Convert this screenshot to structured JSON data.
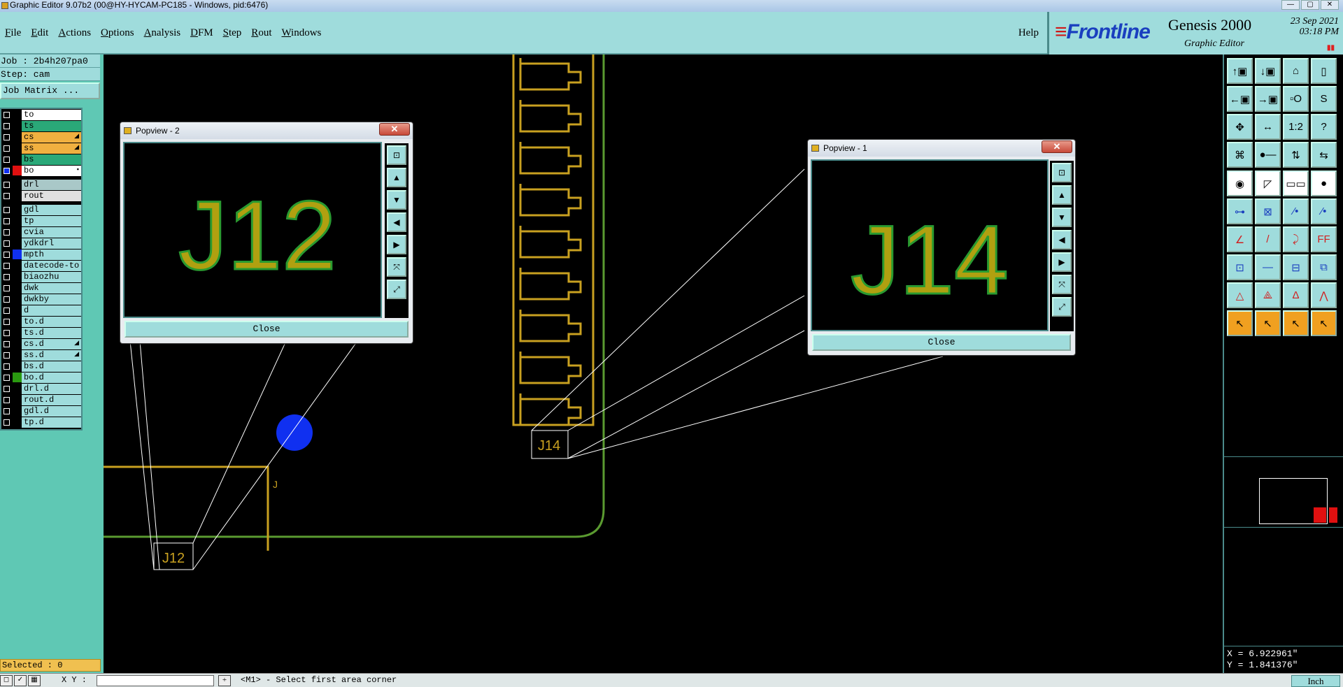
{
  "window": {
    "title": "Graphic Editor 9.07b2 (00@HY-HYCAM-PC185 - Windows, pid:6476)"
  },
  "menu": {
    "items": [
      "File",
      "Edit",
      "Actions",
      "Options",
      "Analysis",
      "DFM",
      "Step",
      "Rout",
      "Windows"
    ],
    "help": "Help"
  },
  "logo": {
    "brand": "Frontline",
    "product": "Genesis 2000",
    "subtitle": "Graphic Editor",
    "date": "23 Sep 2021",
    "time": "03:18 PM"
  },
  "job": {
    "job_line": "Job : 2b4h207pa0",
    "step_line": "Step: cam",
    "matrix_button": "Job Matrix ..."
  },
  "layers": [
    {
      "name": "to",
      "bg": "#ffffff",
      "swatch": "",
      "mark": ""
    },
    {
      "name": "ts",
      "bg": "#2aa878",
      "swatch": "",
      "mark": ""
    },
    {
      "name": "cs",
      "bg": "#f0b040",
      "swatch": "",
      "mark": "◢"
    },
    {
      "name": "ss",
      "bg": "#f0b040",
      "swatch": "",
      "mark": "◢"
    },
    {
      "name": "bs",
      "bg": "#2aa878",
      "swatch": "",
      "mark": ""
    },
    {
      "name": "bo",
      "bg": "#ffffff",
      "swatch": "#e01010",
      "mark": "▪"
    },
    {
      "name": "drl",
      "bg": "#a9c8c8",
      "swatch": "",
      "mark": "",
      "sep": true
    },
    {
      "name": "rout",
      "bg": "#e0e0e0",
      "swatch": "",
      "mark": ""
    },
    {
      "name": "gdl",
      "bg": "#9fdcdc",
      "swatch": "",
      "mark": "",
      "sep": true
    },
    {
      "name": "tp",
      "bg": "#9fdcdc",
      "swatch": "",
      "mark": ""
    },
    {
      "name": "cvia",
      "bg": "#9fdcdc",
      "swatch": "",
      "mark": ""
    },
    {
      "name": "ydkdrl",
      "bg": "#9fdcdc",
      "swatch": "",
      "mark": ""
    },
    {
      "name": "mpth",
      "bg": "#9fdcdc",
      "swatch": "#1030f0",
      "mark": ""
    },
    {
      "name": "datecode-to",
      "bg": "#9fdcdc",
      "swatch": "",
      "mark": ""
    },
    {
      "name": "biaozhu",
      "bg": "#9fdcdc",
      "swatch": "",
      "mark": ""
    },
    {
      "name": "dwk",
      "bg": "#9fdcdc",
      "swatch": "",
      "mark": ""
    },
    {
      "name": "dwkby",
      "bg": "#9fdcdc",
      "swatch": "",
      "mark": ""
    },
    {
      "name": "d",
      "bg": "#9fdcdc",
      "swatch": "",
      "mark": ""
    },
    {
      "name": "to.d",
      "bg": "#9fdcdc",
      "swatch": "",
      "mark": ""
    },
    {
      "name": "ts.d",
      "bg": "#9fdcdc",
      "swatch": "",
      "mark": ""
    },
    {
      "name": "cs.d",
      "bg": "#9fdcdc",
      "swatch": "",
      "mark": "◢"
    },
    {
      "name": "ss.d",
      "bg": "#9fdcdc",
      "swatch": "",
      "mark": "◢"
    },
    {
      "name": "bs.d",
      "bg": "#9fdcdc",
      "swatch": "",
      "mark": ""
    },
    {
      "name": "bo.d",
      "bg": "#9fdcdc",
      "swatch": "#2a9a10",
      "mark": ""
    },
    {
      "name": "drl.d",
      "bg": "#9fdcdc",
      "swatch": "",
      "mark": ""
    },
    {
      "name": "rout.d",
      "bg": "#9fdcdc",
      "swatch": "",
      "mark": ""
    },
    {
      "name": "gdl.d",
      "bg": "#9fdcdc",
      "swatch": "",
      "mark": ""
    },
    {
      "name": "tp.d",
      "bg": "#9fdcdc",
      "swatch": "",
      "mark": ""
    }
  ],
  "status": {
    "selected": "Selected : 0",
    "xy_label": "X Y :",
    "prompt": "<M1> - Select first area corner",
    "units": "Inch"
  },
  "coords": {
    "x": "X = 6.922961\"",
    "y": "Y = 1.841376\""
  },
  "popview2": {
    "title": "Popview - 2",
    "close_label": "Close",
    "label": "J12"
  },
  "popview1": {
    "title": "Popview - 1",
    "close_label": "Close",
    "label": "J14"
  },
  "canvas": {
    "label_j12": "J12",
    "label_j14": "J14",
    "small_mark": "J"
  },
  "toolbar": {
    "row1": [
      "↑▣",
      "↓▣",
      "⌂",
      "▯"
    ],
    "row2": [
      "←▣",
      "→▣",
      "▫O",
      "S"
    ],
    "row3": [
      "✥",
      "↔",
      "1:2",
      "?"
    ],
    "row4": [
      "⌘",
      "●—",
      "⇅",
      "⇆"
    ],
    "row5": [
      "◉",
      "◸",
      "▭▭",
      "●"
    ],
    "row6": [
      "⊶",
      "⊠",
      "⁄•",
      "⁄•"
    ],
    "row7": [
      "∠",
      "/",
      "⤸",
      "FF"
    ],
    "row8": [
      "⊡",
      "—",
      "⊟",
      "⧉"
    ],
    "row9": [
      "△",
      "⟁",
      "Δ",
      "⋀"
    ],
    "row10": [
      "↖",
      "↖",
      "↖",
      "↖"
    ]
  },
  "colors": {
    "trace": "#c8a020",
    "text": "#b0a010",
    "outline": "#5a9a30",
    "lines": "#ffffff",
    "pad": "#1030f0"
  }
}
